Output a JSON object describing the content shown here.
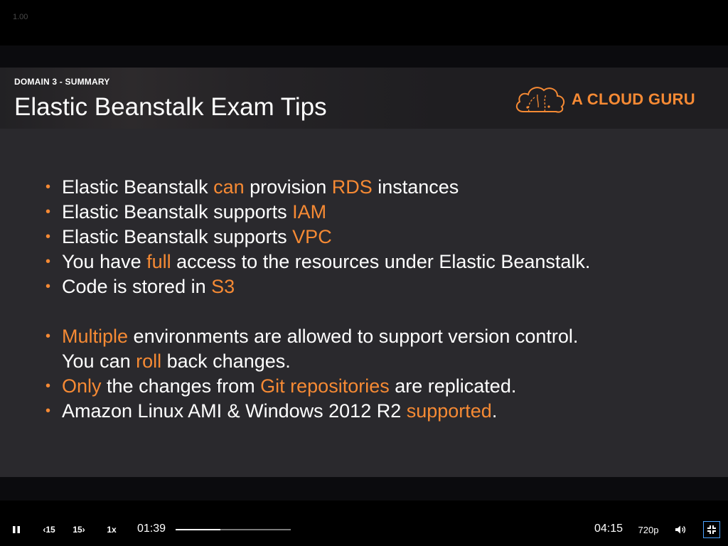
{
  "player": {
    "speed_overlay": "1.00",
    "current_time": "01:39",
    "duration": "04:15",
    "progress_fraction": 0.388,
    "rewind_label": "15",
    "forward_label": "15",
    "speed_label": "1x",
    "quality_label": "720p",
    "icons": [
      "pause-icon",
      "rewind-15-icon",
      "forward-15-icon",
      "volume-icon",
      "exit-fullscreen-icon"
    ]
  },
  "slide": {
    "domain_label": "DOMAIN 3 - SUMMARY",
    "title": "Elastic Beanstalk Exam Tips",
    "brand": "A CLOUD GURU",
    "accent_color": "#f68a34",
    "bullets": [
      [
        {
          "t": "Elastic Beanstalk "
        },
        {
          "t": "can",
          "hl": true
        },
        {
          "t": " provision "
        },
        {
          "t": "RDS",
          "hl": true
        },
        {
          "t": " instances"
        }
      ],
      [
        {
          "t": "Elastic Beanstalk supports "
        },
        {
          "t": "IAM",
          "hl": true
        }
      ],
      [
        {
          "t": "Elastic Beanstalk supports "
        },
        {
          "t": "VPC",
          "hl": true
        }
      ],
      [
        {
          "t": "You have "
        },
        {
          "t": "full",
          "hl": true
        },
        {
          "t": " access to the resources under Elastic Beanstalk."
        }
      ],
      [
        {
          "t": "Code is stored in "
        },
        {
          "t": "S3",
          "hl": true
        }
      ],
      null,
      [
        {
          "t": "Multiple",
          "hl": true
        },
        {
          "t": " environments are allowed to support version control."
        }
      ],
      {
        "continuation": [
          {
            "t": "You can "
          },
          {
            "t": "roll",
            "hl": true
          },
          {
            "t": " back changes."
          }
        ]
      },
      [
        {
          "t": "Only",
          "hl": true
        },
        {
          "t": " the changes from "
        },
        {
          "t": "Git repositories",
          "hl": true
        },
        {
          "t": " are replicated."
        }
      ],
      [
        {
          "t": "Amazon Linux AMI & Windows 2012 R2 "
        },
        {
          "t": "supported",
          "hl": true
        },
        {
          "t": "."
        }
      ]
    ]
  }
}
